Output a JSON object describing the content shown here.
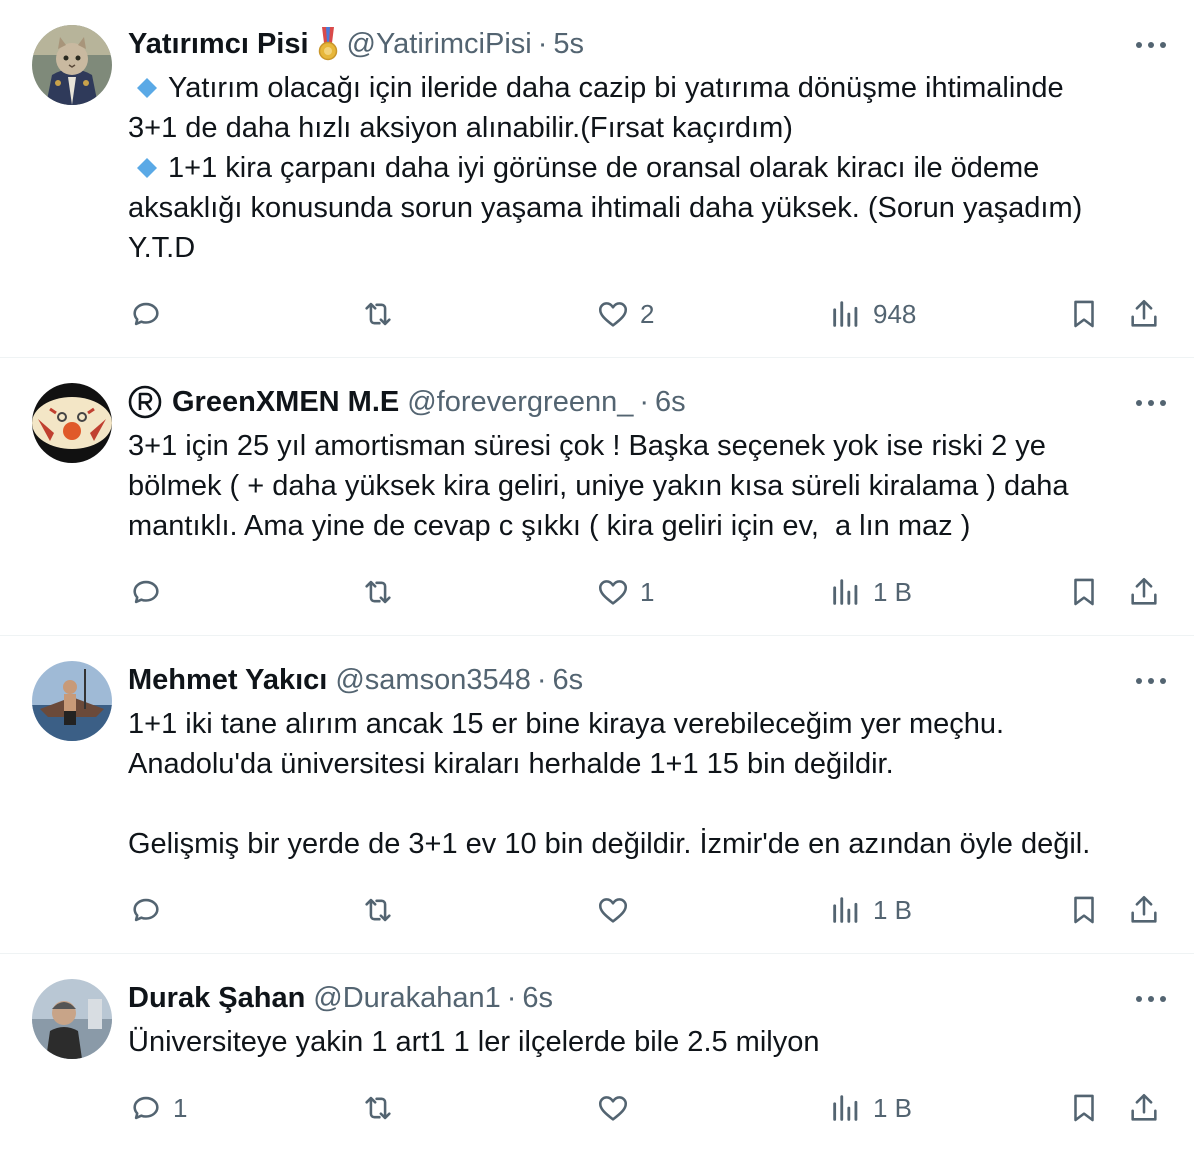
{
  "tweets": [
    {
      "name": "Yatırımcı Pisi",
      "handle": "@YatirimciPisi",
      "separator": "·",
      "time": "5s",
      "lines": [
        "Yatırım olacağı için ileride daha cazip bi yatırıma dönüşme ihtimalinde",
        "3+1 de daha hızlı aksiyon alınabilir.(Fırsat kaçırdım)",
        "1+1 kira çarpanı daha iyi görünse de oransal olarak kiracı ile ödeme",
        "aksaklığı konusunda sorun yaşama ihtimali daha yüksek. (Sorun yaşadım)",
        "Y.T.D"
      ],
      "stats": {
        "replies": "",
        "retweets": "",
        "likes": "2",
        "views": "948"
      }
    },
    {
      "name": "GreenXMEN M.E",
      "handle": "@forevergreenn_",
      "separator": "·",
      "time": "6s",
      "lines": [
        "3+1 için 25 yıl amortisman süresi çok ! Başka seçenek yok ise riski 2 ye",
        "bölmek ( + daha yüksek kira geliri, uniye yakın kısa süreli kiralama ) daha",
        "mantıklı. Ama yine de cevap c şıkkı ( kira geliri için ev,  a lın maz )"
      ],
      "stats": {
        "replies": "",
        "retweets": "",
        "likes": "1",
        "views": "1 B"
      }
    },
    {
      "name": "Mehmet Yakıcı",
      "handle": "@samson3548",
      "separator": "·",
      "time": "6s",
      "lines": [
        "1+1 iki tane alırım ancak 15 er bine kiraya verebileceğim yer meçhu.",
        "Anadolu'da üniversitesi kiraları herhalde 1+1 15 bin değildir.",
        "",
        "Gelişmiş bir yerde de 3+1 ev 10 bin değildir. İzmir'de en azından öyle değil."
      ],
      "stats": {
        "replies": "",
        "retweets": "",
        "likes": "",
        "views": "1 B"
      }
    },
    {
      "name": "Durak Şahan",
      "handle": "@Durakahan1",
      "separator": "·",
      "time": "6s",
      "lines": [
        "Üniversiteye yakin 1 art1 1 ler ilçelerde bile 2.5 milyon"
      ],
      "stats": {
        "replies": "1",
        "retweets": "",
        "likes": "",
        "views": "1 B"
      }
    }
  ],
  "icons": {
    "reply": "reply-icon",
    "retweet": "retweet-icon",
    "like": "heart-icon",
    "views": "views-icon",
    "bookmark": "bookmark-icon",
    "share": "share-icon",
    "more": "more-icon",
    "bullet": "blue-diamond-icon",
    "badge": "medal-badge-icon",
    "registered": "registered-mark-icon"
  },
  "colors": {
    "text": "#0f1419",
    "secondary": "#536471",
    "divider": "#eff3f4",
    "diamond": "#5aa9e6"
  }
}
